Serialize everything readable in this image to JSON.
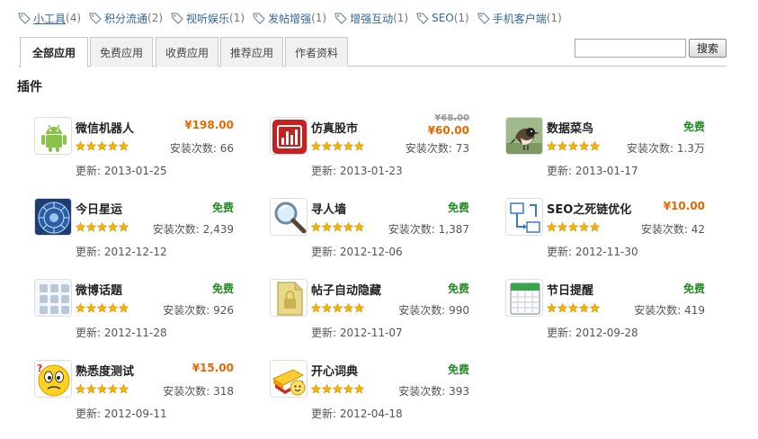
{
  "tags": [
    {
      "label": "小工具",
      "count": "(4)",
      "active": true
    },
    {
      "label": "积分流通",
      "count": "(2)"
    },
    {
      "label": "视听娱乐",
      "count": "(1)"
    },
    {
      "label": "发帖增强",
      "count": "(1)"
    },
    {
      "label": "增强互动",
      "count": "(1)"
    },
    {
      "label": "SEO",
      "count": "(1)"
    },
    {
      "label": "手机客户端",
      "count": "(1)"
    }
  ],
  "tabs": [
    "全部应用",
    "免费应用",
    "收费应用",
    "推荐应用",
    "作者资料"
  ],
  "search": {
    "button": "搜索",
    "value": ""
  },
  "section_title": "插件",
  "apps": [
    {
      "name": "微信机器人",
      "price": "¥198.00",
      "price_type": "paid",
      "installs": "安装次数: 66",
      "updated": "更新: 2013-01-25",
      "icon": "android-robot-icon",
      "rating": 5
    },
    {
      "name": "仿真股市",
      "price_old": "¥68.00",
      "price": "¥60.00",
      "price_type": "discount",
      "installs": "安装次数: 73",
      "updated": "更新: 2013-01-23",
      "icon": "stock-chart-icon",
      "rating": 5
    },
    {
      "name": "数据菜鸟",
      "price": "免费",
      "price_type": "free",
      "installs": "安装次数: 1.3万",
      "updated": "更新: 2013-01-17",
      "icon": "bird-icon",
      "rating": 5
    },
    {
      "name": "今日星运",
      "price": "免费",
      "price_type": "free",
      "installs": "安装次数: 2,439",
      "updated": "更新: 2012-12-12",
      "icon": "zodiac-wheel-icon",
      "rating": 5
    },
    {
      "name": "寻人墙",
      "price": "免费",
      "price_type": "free",
      "installs": "安装次数: 1,387",
      "updated": "更新: 2012-12-06",
      "icon": "magnifier-icon",
      "rating": 5
    },
    {
      "name": "SEO之死链优化",
      "price": "¥10.00",
      "price_type": "paid",
      "installs": "安装次数: 42",
      "updated": "更新: 2012-11-30",
      "icon": "link-sitemap-icon",
      "rating": 5
    },
    {
      "name": "微博话题",
      "price": "免费",
      "price_type": "free",
      "installs": "安装次数: 926",
      "updated": "更新: 2012-11-28",
      "icon": "grid-tiles-icon",
      "rating": 5
    },
    {
      "name": "帖子自动隐藏",
      "price": "免费",
      "price_type": "free",
      "installs": "安装次数: 990",
      "updated": "更新: 2012-11-07",
      "icon": "locked-document-icon",
      "rating": 5
    },
    {
      "name": "节日提醒",
      "price": "免费",
      "price_type": "free",
      "installs": "安装次数: 419",
      "updated": "更新: 2012-09-28",
      "icon": "calendar-icon",
      "rating": 5
    },
    {
      "name": "熟悉度测试",
      "price": "¥15.00",
      "price_type": "paid",
      "installs": "安装次数: 318",
      "updated": "更新: 2012-09-11",
      "icon": "confused-face-icon",
      "rating": 5
    },
    {
      "name": "开心词典",
      "price": "免费",
      "price_type": "free",
      "installs": "安装次数: 393",
      "updated": "更新: 2012-04-18",
      "icon": "books-smiley-icon",
      "rating": 5
    }
  ],
  "colors": {
    "free": "#228b22",
    "paid": "#e06a00",
    "link": "#336699",
    "star": "#f5b400"
  }
}
